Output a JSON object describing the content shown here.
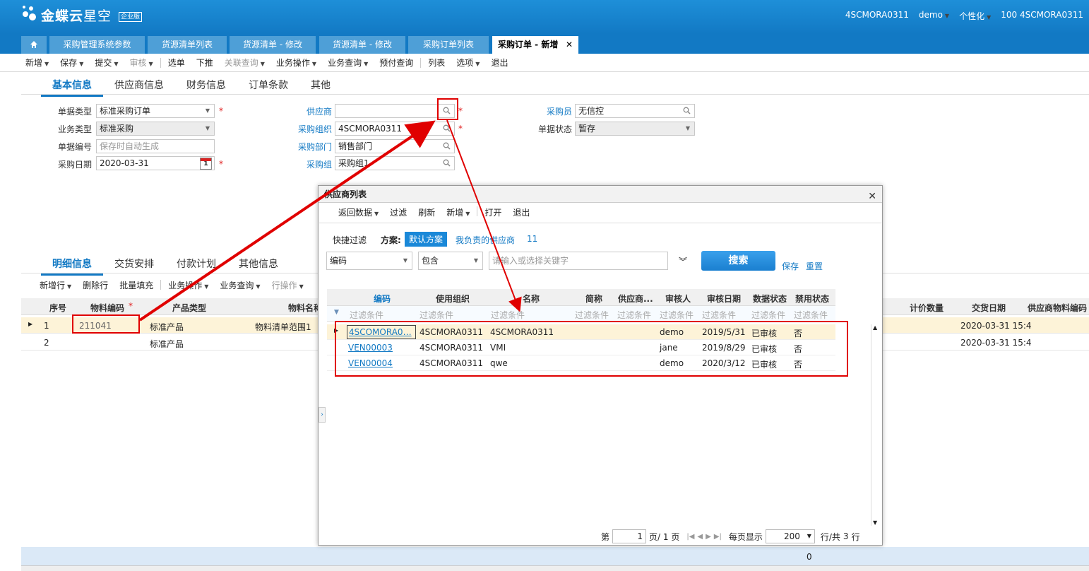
{
  "app": {
    "logo_main": "金蝶云",
    "logo_sub": "星空",
    "edition": "企业版"
  },
  "user": {
    "org": "4SCMORA0311",
    "name": "demo",
    "personalize": "个性化",
    "org2": "100 4SCMORA0311"
  },
  "tabs": [
    {
      "label": "采购管理系统参数"
    },
    {
      "label": "货源清单列表"
    },
    {
      "label": "货源清单 - 修改"
    },
    {
      "label": "货源清单 - 修改"
    },
    {
      "label": "采购订单列表"
    },
    {
      "label": "采购订单 - 新增"
    }
  ],
  "toolbar": {
    "new": "新增",
    "save": "保存",
    "submit": "提交",
    "audit": "审核",
    "select": "选单",
    "push": "下推",
    "related": "关联查询",
    "bizop": "业务操作",
    "bizquery": "业务查询",
    "prepay": "预付查询",
    "list": "列表",
    "options": "选项",
    "exit": "退出"
  },
  "subtabs": {
    "basic": "基本信息",
    "supplier": "供应商信息",
    "finance": "财务信息",
    "terms": "订单条款",
    "other": "其他"
  },
  "form": {
    "bill_type_label": "单据类型",
    "bill_type": "标准采购订单",
    "biz_type_label": "业务类型",
    "biz_type": "标准采购",
    "bill_no_label": "单据编号",
    "bill_no_ph": "保存时自动生成",
    "date_label": "采购日期",
    "date": "2020-03-31",
    "cal_day": "1",
    "supplier_label": "供应商",
    "supplier": "",
    "purch_org_label": "采购组织",
    "purch_org": "4SCMORA0311",
    "dept_label": "采购部门",
    "dept": "销售部门",
    "group_label": "采购组",
    "group": "采购组1",
    "buyer_label": "采购员",
    "buyer": "无信控",
    "status_label": "单据状态",
    "status": "暂存",
    "req": "*"
  },
  "detail_tabs": {
    "detail": "明细信息",
    "delivery": "交货安排",
    "payment": "付款计划",
    "other": "其他信息"
  },
  "detail_toolbar": {
    "add_row": "新增行",
    "del_row": "删除行",
    "batch_fill": "批量填充",
    "bizop": "业务操作",
    "bizquery": "业务查询",
    "rowop": "行操作"
  },
  "grid": {
    "headers": {
      "seq": "序号",
      "material_code": "物料编码",
      "product_type": "产品类型",
      "material_name": "物料名称",
      "qty": "计价数量",
      "delivery_date": "交货日期",
      "supplier_mat": "供应商物料编码"
    },
    "rows": [
      {
        "seq": "1",
        "material_code": "211041",
        "product_type": "标准产品",
        "material_name": "物料清单范围1",
        "delivery_date": "2020-03-31 15:4"
      },
      {
        "seq": "2",
        "material_code": "",
        "product_type": "标准产品",
        "material_name": "",
        "delivery_date": "2020-03-31 15:4"
      }
    ],
    "total": "0"
  },
  "dialog": {
    "title": "供应商列表",
    "toolbar": {
      "return": "返回数据",
      "filter": "过滤",
      "refresh": "刷新",
      "new": "新增",
      "open": "打开",
      "exit": "退出"
    },
    "quick_filter": "快捷过滤",
    "scheme_label": "方案:",
    "scheme_default": "默认方案",
    "scheme_mine": "我负责的供应商",
    "scheme_count": "11",
    "filter_field": "编码",
    "filter_op": "包含",
    "keyword_ph": "请输入或选择关键字",
    "search": "搜索",
    "save": "保存",
    "reset": "重置",
    "headers": {
      "code": "编码",
      "org": "使用组织",
      "name": "名称",
      "short": "简称",
      "group": "供应商...",
      "auditor": "审核人",
      "audit_date": "审核日期",
      "data_status": "数据状态",
      "forbid": "禁用状态"
    },
    "filter_placeholder": "过滤条件",
    "rows": [
      {
        "code": "4SCOMORA0…",
        "org": "4SCMORA0311",
        "name": "4SCMORA0311",
        "auditor": "demo",
        "audit_date": "2019/5/31",
        "data_status": "已审核",
        "forbid": "否"
      },
      {
        "code": "VEN00003",
        "org": "4SCMORA0311",
        "name": "VMI",
        "auditor": "jane",
        "audit_date": "2019/8/29",
        "data_status": "已审核",
        "forbid": "否"
      },
      {
        "code": "VEN00004",
        "org": "4SCMORA0311",
        "name": "qwe",
        "auditor": "demo",
        "audit_date": "2020/3/12",
        "data_status": "已审核",
        "forbid": "否"
      }
    ],
    "pager": {
      "page_label": "第",
      "page": "1",
      "page_of": "页/ 1 页",
      "per_page_label": "每页显示",
      "per_page": "200",
      "rows_total": "行/共",
      "total": "3",
      "rows_unit": "行"
    }
  },
  "colors": {
    "brand": "#1279c4",
    "highlight": "#e00000",
    "selected_row": "#fdf3d8"
  }
}
